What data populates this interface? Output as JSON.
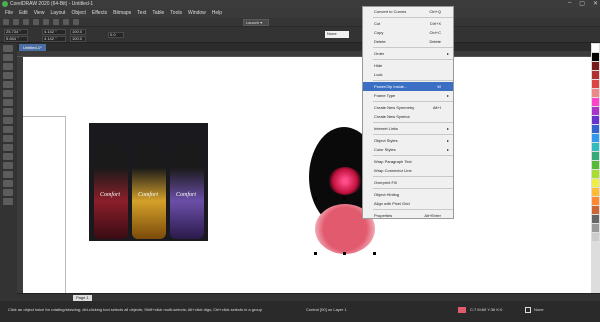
{
  "window": {
    "title": "CorelDRAW 2020 (64-Bit) - Untitled-1",
    "controls": [
      "–",
      "▢",
      "✕"
    ]
  },
  "menubar": {
    "items": [
      "File",
      "Edit",
      "View",
      "Layout",
      "Object",
      "Effects",
      "Bitmaps",
      "Text",
      "Table",
      "Tools",
      "Window",
      "Help"
    ]
  },
  "toolbar": {
    "launch_label": "Launch ▾"
  },
  "property_bar": {
    "x": "25.734 \"",
    "y": "5.654 \"",
    "width": "4.142 \"",
    "height": "4.142 \"",
    "scale_w": "100.0",
    "scale_h": "100.0",
    "angle": "0.0",
    "outline": "None"
  },
  "document_tab": "Untitled-1*",
  "context_menu": {
    "items": [
      {
        "label": "Convert to Curves",
        "shortcut": "Ctrl+Q",
        "sep_after": true
      },
      {
        "label": "Cut",
        "shortcut": "Ctrl+X"
      },
      {
        "label": "Copy",
        "shortcut": "Ctrl+C"
      },
      {
        "label": "Delete",
        "shortcut": "Delete",
        "sep_after": true
      },
      {
        "label": "Order",
        "arrow": "▸",
        "sep_after": true
      },
      {
        "label": "Hide"
      },
      {
        "label": "Lock",
        "sep_after": true
      },
      {
        "label": "PowerClip Inside...",
        "shortcut": "W",
        "selected": true
      },
      {
        "label": "Frame Type",
        "arrow": "▸",
        "sep_after": true
      },
      {
        "label": "Create New Symmetry",
        "shortcut": "Alt+I"
      },
      {
        "label": "Create New Symbol",
        "sep_after": true
      },
      {
        "label": "Internet Links",
        "arrow": "▸",
        "sep_after": true
      },
      {
        "label": "Object Styles",
        "arrow": "▸"
      },
      {
        "label": "Color Styles",
        "arrow": "▸",
        "sep_after": true
      },
      {
        "label": "Wrap Paragraph Text"
      },
      {
        "label": "Wrap Connector Line",
        "sep_after": true
      },
      {
        "label": "Overprint Fill",
        "sep_after": true
      },
      {
        "label": "Object Hinting"
      },
      {
        "label": "Align with Pixel Grid",
        "sep_after": true
      },
      {
        "label": "Properties",
        "shortcut": "Alt+Enter"
      }
    ]
  },
  "image_label": "Comfort",
  "page_tab": "Page 1",
  "status": {
    "message": "Click an object twice for rotating/skewing; dbl-clicking tool selects all objects; Shift+click multi-selects; Alt+click digs; Ctrl+click selects in a group",
    "layer": "Control [00] on Layer 1",
    "fill": "C:7 M:69 Y:36 K:0",
    "outline": "None"
  },
  "colors": {
    "ui_bg": "#2b2b2b",
    "selection": "#3b6fc4",
    "fill_color": "#e25a6e",
    "palette": [
      "#ffffff",
      "#000000",
      "#e25a6e",
      "#7a1a1a",
      "#b03030",
      "#d44",
      "#e88",
      "#f4c",
      "#a3c",
      "#63c",
      "#36c",
      "#39e",
      "#3bb",
      "#3a7",
      "#5b3",
      "#ad3",
      "#ee4",
      "#fb3",
      "#f83",
      "#c63",
      "#963",
      "#666",
      "#999",
      "#ccc"
    ]
  }
}
